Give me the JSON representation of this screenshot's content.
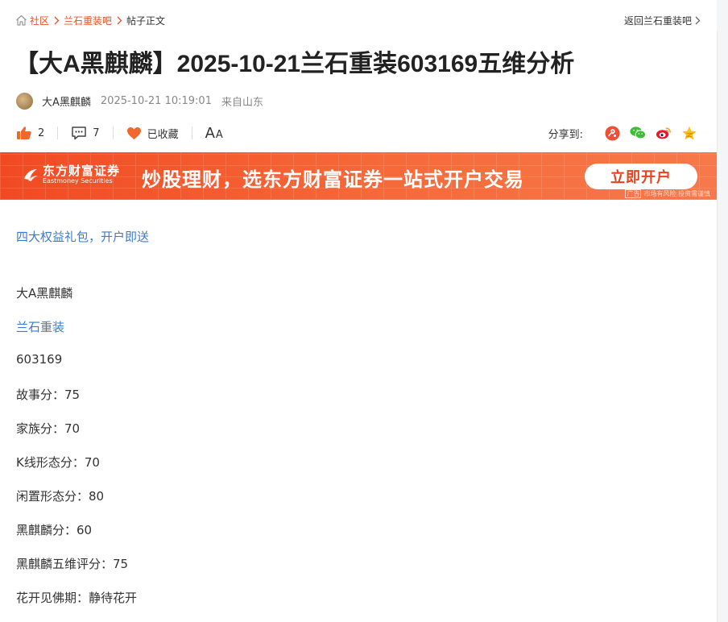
{
  "breadcrumb": {
    "home_label": "社区",
    "forum_label": "兰石重装吧",
    "current_label": "帖子正文",
    "back_label": "返回兰石重装吧"
  },
  "post": {
    "title": "【大A黑麒麟】2025-10-21兰石重装603169五维分析",
    "author": "大A黑麒麟",
    "time": "2025-10-21 10:19:01",
    "location": "来自山东"
  },
  "actions": {
    "like_count": "2",
    "comment_count": "7",
    "favorite_label": "已收藏",
    "font_big": "A",
    "font_small": "A",
    "share_label": "分享到:",
    "share_icons": [
      "weibo-tencent-icon",
      "wechat-icon",
      "weibo-icon",
      "qzone-icon"
    ]
  },
  "banner": {
    "brand_cn": "东方财富证券",
    "brand_en": "Eastmoney Securities",
    "slogan": "炒股理财，选东方财富证券一站式开户交易",
    "cta": "立即开户",
    "ad_tag": "广告",
    "ad_note": "市场有风险 投资需谨慎"
  },
  "content": {
    "promo": "四大权益礼包，开户即送",
    "lines": [
      {
        "text": "大A黑麒麟",
        "link": false
      },
      {
        "text": "兰石重装",
        "link": true
      },
      {
        "text": "603169",
        "link": false
      },
      {
        "text": "故事分：75",
        "link": false
      },
      {
        "text": "家族分：70",
        "link": false
      },
      {
        "text": "K线形态分：70",
        "link": false
      },
      {
        "text": "闲置形态分：80",
        "link": false
      },
      {
        "text": "黑麒麟分：60",
        "link": false
      },
      {
        "text": "黑麒麟五维评分：75",
        "link": false
      },
      {
        "text": "花开见佛期：静待花开",
        "link": false
      }
    ]
  },
  "colors": {
    "accent": "#e5532c",
    "link": "#3a7bd5",
    "banner": "#f14a22"
  }
}
